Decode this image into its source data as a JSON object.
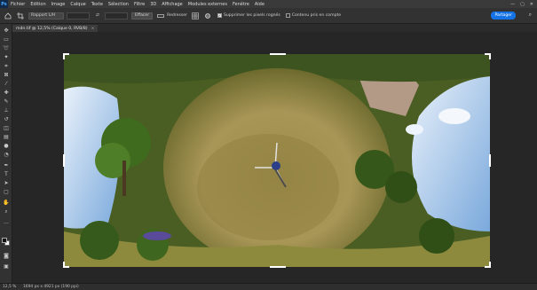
{
  "app": {
    "logo": "Ps"
  },
  "menu": [
    "Fichier",
    "Edition",
    "Image",
    "Calque",
    "Texte",
    "Sélection",
    "Filtre",
    "3D",
    "Affichage",
    "Modules externes",
    "Fenêtre",
    "Aide"
  ],
  "window_controls": {
    "minimize": "—",
    "maximize": "▢",
    "close": "✕"
  },
  "options": {
    "ratio_select": "Rapport L/H",
    "swap_icon": "⇄",
    "clear_button": "Effacer",
    "straighten_label": "Redresser",
    "delete_cropped_label": "Supprimer les pixels rognés",
    "delete_cropped_checked": true,
    "content_aware_label": "Contenu pris en compte",
    "content_aware_checked": false,
    "share_button": "Partager"
  },
  "document": {
    "tab_title": "mdn.tif @ 12,5% (Calque 0, RVB/8)",
    "close": "×"
  },
  "status": {
    "zoom": "12,5 %",
    "info": "1694 px x 4921 px (190 ppi)"
  },
  "colors": {
    "accent": "#1473e6",
    "foreground": "#111111",
    "background": "#ffffff"
  }
}
